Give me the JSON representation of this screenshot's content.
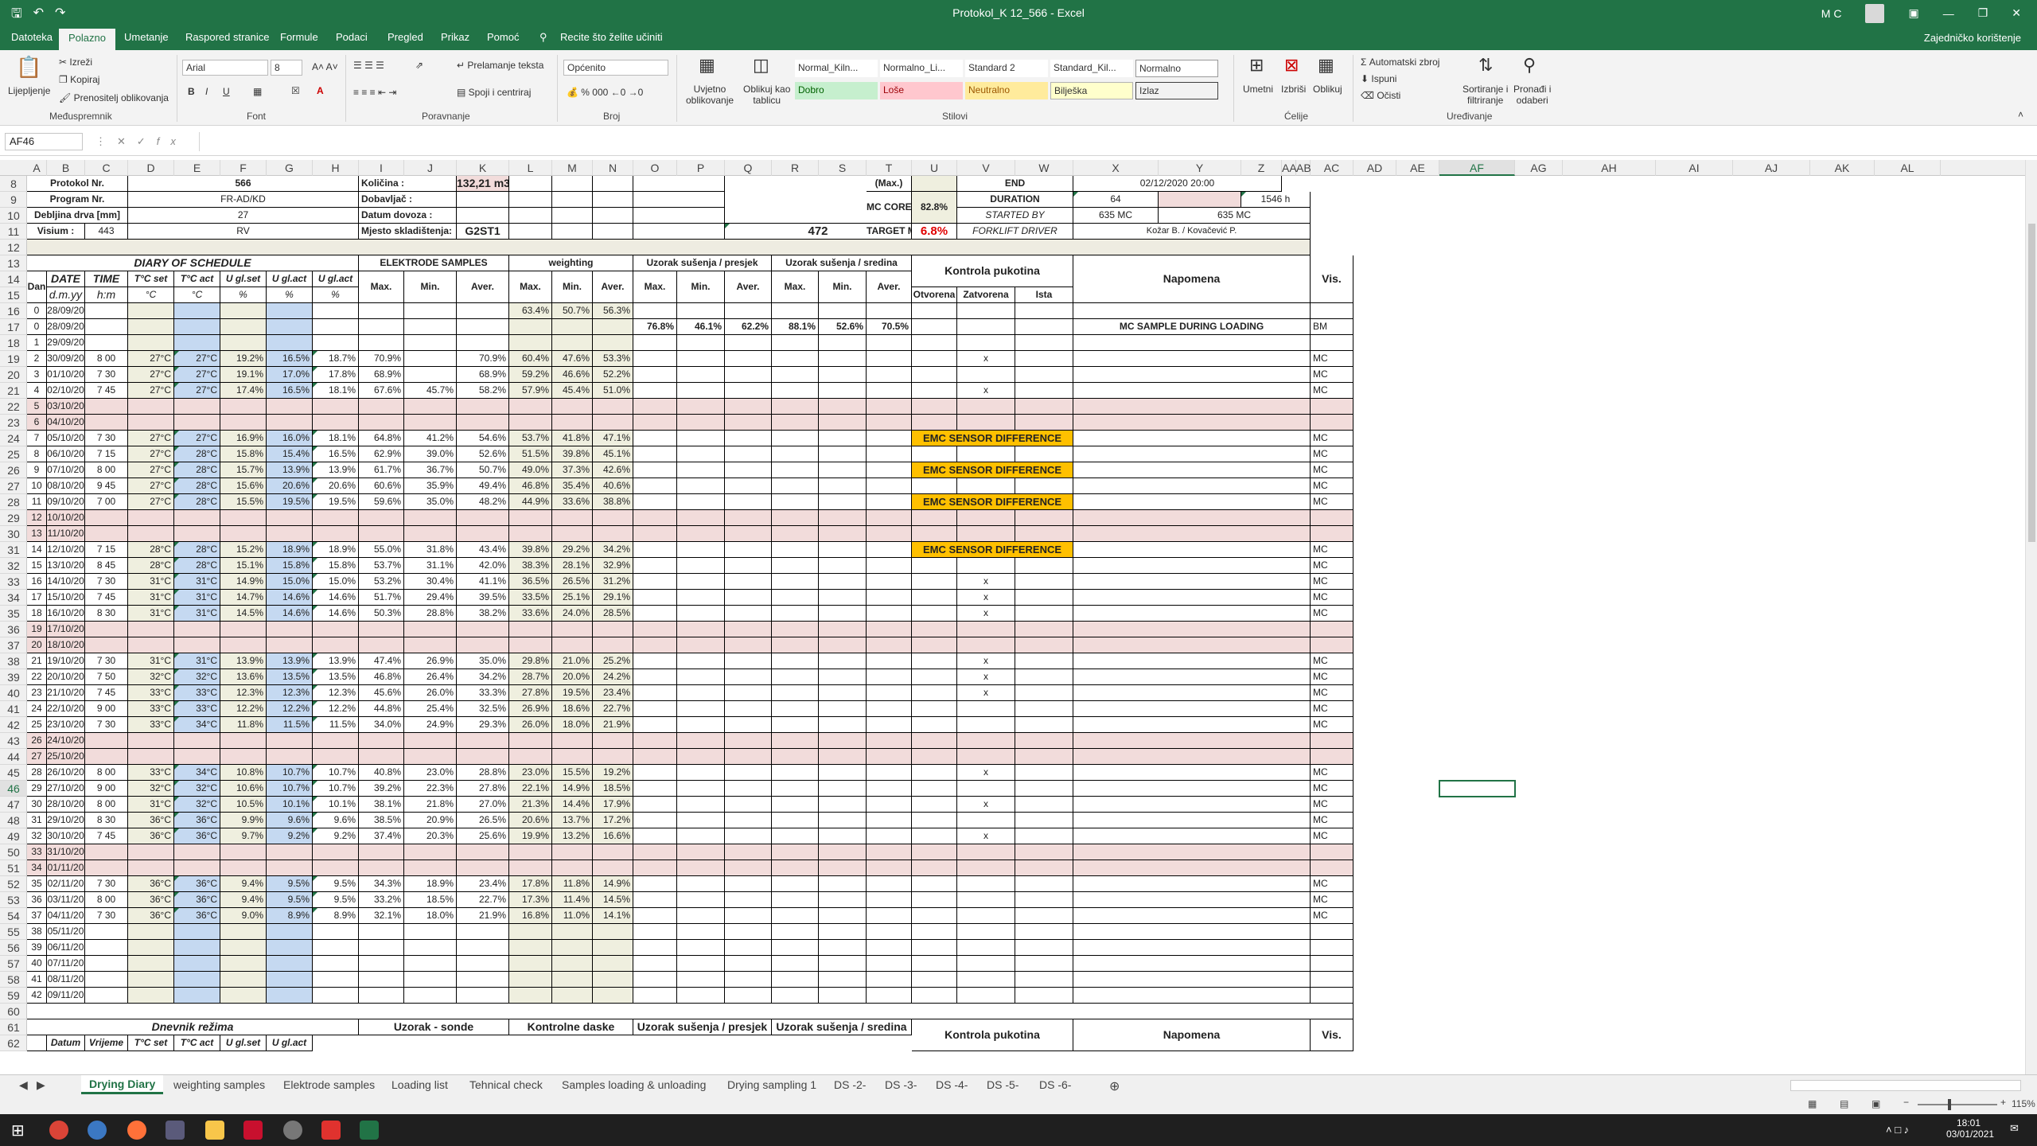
{
  "window": {
    "title": "Protokol_K 12_566  -  Excel",
    "user": "M C",
    "share": "Zajedničko korištenje"
  },
  "tabs": [
    "Datoteka",
    "Polazno",
    "Umetanje",
    "Raspored stranice",
    "Formule",
    "Podaci",
    "Pregled",
    "Prikaz",
    "Pomoć",
    "Recite što želite učiniti"
  ],
  "ribbon": {
    "clipboard": {
      "paste": "Lijepljenje",
      "cut": "Izreži",
      "copy": "Kopiraj",
      "painter": "Prenositelj oblikovanja",
      "group": "Međuspremnik"
    },
    "font": {
      "name": "Arial",
      "size": "8",
      "group": "Font"
    },
    "align": {
      "wrap": "Prelamanje teksta",
      "merge": "Spoji i centriraj",
      "group": "Poravnanje"
    },
    "number": {
      "format": "Općenito",
      "group": "Broj"
    },
    "styles": {
      "cond1": "Uvjetno",
      "cond2": "oblikovanje",
      "table1": "Oblikuj kao",
      "table2": "tablicu",
      "group": "Stilovi",
      "items": [
        "Normal_Kiln...",
        "Normalno_Li...",
        "Standard 2",
        "Standard_Kil...",
        "Normalno",
        "Dobro",
        "Loše",
        "Neutralno",
        "Bilješka",
        "Izlaz"
      ]
    },
    "cells": {
      "insert": "Umetni",
      "delete": "Izbriši",
      "format": "Oblikuj",
      "group": "Ćelije"
    },
    "editing": {
      "autosum": "Automatski zbroj",
      "fill": "Ispuni",
      "clear": "Očisti",
      "sort1": "Sortiranje i",
      "sort2": "filtriranje",
      "find1": "Pronađi i",
      "find2": "odaberi",
      "group": "Uređivanje"
    }
  },
  "namebox": "AF46",
  "columns": [
    "A",
    "B",
    "C",
    "D",
    "E",
    "F",
    "G",
    "H",
    "I",
    "J",
    "K",
    "L",
    "M",
    "N",
    "O",
    "P",
    "Q",
    "R",
    "S",
    "T",
    "U",
    "V",
    "W",
    "X",
    "Y",
    "Z",
    "AA",
    "AB",
    "AC",
    "AD",
    "AE",
    "AF",
    "AG",
    "AH",
    "AI",
    "AJ",
    "AK",
    "AL"
  ],
  "rows": [
    "8",
    "9",
    "10",
    "11",
    "12",
    "13",
    "14",
    "15",
    "16",
    "17",
    "18",
    "19",
    "20",
    "21",
    "22",
    "23",
    "24",
    "25",
    "26",
    "27",
    "28",
    "29",
    "30",
    "31",
    "32",
    "33",
    "34",
    "35",
    "36",
    "37",
    "38",
    "39",
    "40",
    "41",
    "42",
    "43",
    "44",
    "45",
    "46",
    "47",
    "48",
    "49",
    "50",
    "51",
    "52",
    "53",
    "54",
    "55",
    "56",
    "57",
    "58",
    "59",
    "60",
    "61",
    "62"
  ],
  "header": {
    "protokol_l": "Protokol Nr.",
    "protokol_v": "566",
    "kolicina_l": "Količina :",
    "kolicina_v": "132,21 m3",
    "program_l": "Program Nr.",
    "program_v": "FR-AD/KD",
    "dobavljac_l": "Dobavljač :",
    "debljina_l": "Debljina drva [mm]",
    "debljina_v": "27",
    "datum_l": "Datum dovoza :",
    "visium_l": "Visium :",
    "visium_v": "443",
    "visium_rv": "RV",
    "mjesto_l": "Mjesto skladištenja:",
    "mjesto_v": "G2ST1",
    "v472": "472",
    "max_l": "(Max.)",
    "end_l": "END",
    "end_v": "02/12/2020 20:00",
    "mccore_l": "MC CORE (Max.)",
    "mccore_v": "82.8%",
    "duration_l": "DURATION",
    "duration_v1": "64",
    "duration_v2": "1546 h",
    "started_l": "STARTED BY",
    "started_v1": "635 MC",
    "started_v2": "635 MC",
    "target_l": "TARGET MC",
    "target_v": "6.8%",
    "fork_l": "FORKLIFT DRIVER",
    "fork_v": "Kožar B. / Kovačević P."
  },
  "table_head": {
    "diary": "DIARY OF SCHEDULE",
    "dan": "Dan",
    "date": "DATE",
    "time": "TIME",
    "tset": "T°C set",
    "tact": "T°C act",
    "uset": "U gl.set",
    "uact": "U gl.act",
    "uact2": "U gl.act",
    "dmy": "d.m.yy",
    "hm": "h:m",
    "c": "°C",
    "pct": "%",
    "elektrode": "ELEKTRODE SAMPLES",
    "weighting": "weighting",
    "presjek": "Uzorak sušenja / presjek",
    "sredina": "Uzorak sušenja / sredina",
    "max": "Max.",
    "min": "Min.",
    "aver": "Aver.",
    "kontrola": "Kontrola pukotina",
    "otvorena": "Otvorena",
    "zatvorena": "Zatvorena",
    "ista": "Ista",
    "napomena": "Napomena",
    "vis": "Vis."
  },
  "data_rows": [
    [
      "0",
      "28/09/20",
      "",
      "",
      "",
      "",
      "",
      "",
      "",
      "",
      "",
      "63.4%",
      "50.7%",
      "56.3%",
      "",
      "",
      "",
      "",
      "",
      "",
      "",
      "",
      "",
      "",
      "",
      ""
    ],
    [
      "0",
      "28/09/20",
      "",
      "",
      "",
      "",
      "",
      "",
      "",
      "",
      "",
      "",
      "",
      "",
      "76.8%",
      "46.1%",
      "62.2%",
      "88.1%",
      "52.6%",
      "70.5%",
      "",
      "",
      "",
      "",
      "MC SAMPLE DURING LOADING",
      "BM"
    ],
    [
      "1",
      "29/09/20",
      "",
      "",
      "",
      "",
      "",
      "",
      "",
      "",
      "",
      "",
      "",
      "",
      "",
      "",
      "",
      "",
      "",
      "",
      "",
      "",
      "",
      "",
      "",
      ""
    ],
    [
      "2",
      "30/09/20",
      "8 00",
      "27°C",
      "27°C",
      "19.2%",
      "16.5%",
      "18.7%",
      "70.9%",
      "",
      "70.9%",
      "60.4%",
      "47.6%",
      "53.3%",
      "",
      "",
      "",
      "",
      "",
      "",
      "",
      "x",
      "",
      "",
      "",
      "MC"
    ],
    [
      "3",
      "01/10/20",
      "7 30",
      "27°C",
      "27°C",
      "19.1%",
      "17.0%",
      "17.8%",
      "68.9%",
      "",
      "68.9%",
      "59.2%",
      "46.6%",
      "52.2%",
      "",
      "",
      "",
      "",
      "",
      "",
      "",
      "",
      "",
      "",
      "",
      "MC"
    ],
    [
      "4",
      "02/10/20",
      "7 45",
      "27°C",
      "27°C",
      "17.4%",
      "16.5%",
      "18.1%",
      "67.6%",
      "45.7%",
      "58.2%",
      "57.9%",
      "45.4%",
      "51.0%",
      "",
      "",
      "",
      "",
      "",
      "",
      "",
      "x",
      "",
      "",
      "",
      "MC"
    ],
    [
      "5",
      "03/10/20",
      "",
      "",
      "",
      "",
      "",
      "",
      "",
      "",
      "",
      "",
      "",
      "",
      "",
      "",
      "",
      "",
      "",
      "",
      "",
      "",
      "",
      "",
      "",
      ""
    ],
    [
      "6",
      "04/10/20",
      "",
      "",
      "",
      "",
      "",
      "",
      "",
      "",
      "",
      "",
      "",
      "",
      "",
      "",
      "",
      "",
      "",
      "",
      "",
      "",
      "",
      "",
      "",
      ""
    ],
    [
      "7",
      "05/10/20",
      "7 30",
      "27°C",
      "27°C",
      "16.9%",
      "16.0%",
      "18.1%",
      "64.8%",
      "41.2%",
      "54.6%",
      "53.7%",
      "41.8%",
      "47.1%",
      "",
      "",
      "",
      "",
      "",
      "",
      "EMC SENSOR DIFFERENCE",
      "",
      "",
      "",
      "",
      "MC"
    ],
    [
      "8",
      "06/10/20",
      "7 15",
      "27°C",
      "28°C",
      "15.8%",
      "15.4%",
      "16.5%",
      "62.9%",
      "39.0%",
      "52.6%",
      "51.5%",
      "39.8%",
      "45.1%",
      "",
      "",
      "",
      "",
      "",
      "",
      "",
      "",
      "",
      "",
      "",
      "MC"
    ],
    [
      "9",
      "07/10/20",
      "8 00",
      "27°C",
      "28°C",
      "15.7%",
      "13.9%",
      "13.9%",
      "61.7%",
      "36.7%",
      "50.7%",
      "49.0%",
      "37.3%",
      "42.6%",
      "",
      "",
      "",
      "",
      "",
      "",
      "EMC SENSOR DIFFERENCE",
      "",
      "",
      "",
      "",
      "MC"
    ],
    [
      "10",
      "08/10/20",
      "9 45",
      "27°C",
      "28°C",
      "15.6%",
      "20.6%",
      "20.6%",
      "60.6%",
      "35.9%",
      "49.4%",
      "46.8%",
      "35.4%",
      "40.6%",
      "",
      "",
      "",
      "",
      "",
      "",
      "",
      "",
      "",
      "",
      "",
      "MC"
    ],
    [
      "11",
      "09/10/20",
      "7 00",
      "27°C",
      "28°C",
      "15.5%",
      "19.5%",
      "19.5%",
      "59.6%",
      "35.0%",
      "48.2%",
      "44.9%",
      "33.6%",
      "38.8%",
      "",
      "",
      "",
      "",
      "",
      "",
      "EMC SENSOR DIFFERENCE",
      "",
      "",
      "",
      "",
      "MC"
    ],
    [
      "12",
      "10/10/20",
      "",
      "",
      "",
      "",
      "",
      "",
      "",
      "",
      "",
      "",
      "",
      "",
      "",
      "",
      "",
      "",
      "",
      "",
      "",
      "",
      "",
      "",
      "",
      ""
    ],
    [
      "13",
      "11/10/20",
      "",
      "",
      "",
      "",
      "",
      "",
      "",
      "",
      "",
      "",
      "",
      "",
      "",
      "",
      "",
      "",
      "",
      "",
      "",
      "",
      "",
      "",
      "",
      ""
    ],
    [
      "14",
      "12/10/20",
      "7 15",
      "28°C",
      "28°C",
      "15.2%",
      "18.9%",
      "18.9%",
      "55.0%",
      "31.8%",
      "43.4%",
      "39.8%",
      "29.2%",
      "34.2%",
      "",
      "",
      "",
      "",
      "",
      "",
      "EMC SENSOR DIFFERENCE",
      "",
      "",
      "",
      "",
      "MC"
    ],
    [
      "15",
      "13/10/20",
      "8 45",
      "28°C",
      "28°C",
      "15.1%",
      "15.8%",
      "15.8%",
      "53.7%",
      "31.1%",
      "42.0%",
      "38.3%",
      "28.1%",
      "32.9%",
      "",
      "",
      "",
      "",
      "",
      "",
      "",
      "",
      "",
      "",
      "",
      "MC"
    ],
    [
      "16",
      "14/10/20",
      "7 30",
      "31°C",
      "31°C",
      "14.9%",
      "15.0%",
      "15.0%",
      "53.2%",
      "30.4%",
      "41.1%",
      "36.5%",
      "26.5%",
      "31.2%",
      "",
      "",
      "",
      "",
      "",
      "",
      "",
      "x",
      "",
      "",
      "",
      "MC"
    ],
    [
      "17",
      "15/10/20",
      "7 45",
      "31°C",
      "31°C",
      "14.7%",
      "14.6%",
      "14.6%",
      "51.7%",
      "29.4%",
      "39.5%",
      "33.5%",
      "25.1%",
      "29.1%",
      "",
      "",
      "",
      "",
      "",
      "",
      "",
      "x",
      "",
      "",
      "",
      "MC"
    ],
    [
      "18",
      "16/10/20",
      "8 30",
      "31°C",
      "31°C",
      "14.5%",
      "14.6%",
      "14.6%",
      "50.3%",
      "28.8%",
      "38.2%",
      "33.6%",
      "24.0%",
      "28.5%",
      "",
      "",
      "",
      "",
      "",
      "",
      "",
      "x",
      "",
      "",
      "",
      "MC"
    ],
    [
      "19",
      "17/10/20",
      "",
      "",
      "",
      "",
      "",
      "",
      "",
      "",
      "",
      "",
      "",
      "",
      "",
      "",
      "",
      "",
      "",
      "",
      "",
      "",
      "",
      "",
      "",
      ""
    ],
    [
      "20",
      "18/10/20",
      "",
      "",
      "",
      "",
      "",
      "",
      "",
      "",
      "",
      "",
      "",
      "",
      "",
      "",
      "",
      "",
      "",
      "",
      "",
      "",
      "",
      "",
      "",
      ""
    ],
    [
      "21",
      "19/10/20",
      "7 30",
      "31°C",
      "31°C",
      "13.9%",
      "13.9%",
      "13.9%",
      "47.4%",
      "26.9%",
      "35.0%",
      "29.8%",
      "21.0%",
      "25.2%",
      "",
      "",
      "",
      "",
      "",
      "",
      "",
      "x",
      "",
      "",
      "",
      "MC"
    ],
    [
      "22",
      "20/10/20",
      "7 50",
      "32°C",
      "32°C",
      "13.6%",
      "13.5%",
      "13.5%",
      "46.8%",
      "26.4%",
      "34.2%",
      "28.7%",
      "20.0%",
      "24.2%",
      "",
      "",
      "",
      "",
      "",
      "",
      "",
      "x",
      "",
      "",
      "",
      "MC"
    ],
    [
      "23",
      "21/10/20",
      "7 45",
      "33°C",
      "33°C",
      "12.3%",
      "12.3%",
      "12.3%",
      "45.6%",
      "26.0%",
      "33.3%",
      "27.8%",
      "19.5%",
      "23.4%",
      "",
      "",
      "",
      "",
      "",
      "",
      "",
      "x",
      "",
      "",
      "",
      "MC"
    ],
    [
      "24",
      "22/10/20",
      "9 00",
      "33°C",
      "33°C",
      "12.2%",
      "12.2%",
      "12.2%",
      "44.8%",
      "25.4%",
      "32.5%",
      "26.9%",
      "18.6%",
      "22.7%",
      "",
      "",
      "",
      "",
      "",
      "",
      "",
      "",
      "",
      "",
      "",
      "MC"
    ],
    [
      "25",
      "23/10/20",
      "7 30",
      "33°C",
      "34°C",
      "11.8%",
      "11.5%",
      "11.5%",
      "34.0%",
      "24.9%",
      "29.3%",
      "26.0%",
      "18.0%",
      "21.9%",
      "",
      "",
      "",
      "",
      "",
      "",
      "",
      "",
      "",
      "",
      "",
      "MC"
    ],
    [
      "26",
      "24/10/20",
      "",
      "",
      "",
      "",
      "",
      "",
      "",
      "",
      "",
      "",
      "",
      "",
      "",
      "",
      "",
      "",
      "",
      "",
      "",
      "",
      "",
      "",
      "",
      ""
    ],
    [
      "27",
      "25/10/20",
      "",
      "",
      "",
      "",
      "",
      "",
      "",
      "",
      "",
      "",
      "",
      "",
      "",
      "",
      "",
      "",
      "",
      "",
      "",
      "",
      "",
      "",
      "",
      ""
    ],
    [
      "28",
      "26/10/20",
      "8 00",
      "33°C",
      "34°C",
      "10.8%",
      "10.7%",
      "10.7%",
      "40.8%",
      "23.0%",
      "28.8%",
      "23.0%",
      "15.5%",
      "19.2%",
      "",
      "",
      "",
      "",
      "",
      "",
      "",
      "x",
      "",
      "",
      "",
      "MC"
    ],
    [
      "29",
      "27/10/20",
      "9 00",
      "32°C",
      "32°C",
      "10.6%",
      "10.7%",
      "10.7%",
      "39.2%",
      "22.3%",
      "27.8%",
      "22.1%",
      "14.9%",
      "18.5%",
      "",
      "",
      "",
      "",
      "",
      "",
      "",
      "",
      "",
      "",
      "",
      "MC"
    ],
    [
      "30",
      "28/10/20",
      "8 00",
      "31°C",
      "32°C",
      "10.5%",
      "10.1%",
      "10.1%",
      "38.1%",
      "21.8%",
      "27.0%",
      "21.3%",
      "14.4%",
      "17.9%",
      "",
      "",
      "",
      "",
      "",
      "",
      "",
      "x",
      "",
      "",
      "",
      "MC"
    ],
    [
      "31",
      "29/10/20",
      "8 30",
      "36°C",
      "36°C",
      "9.9%",
      "9.6%",
      "9.6%",
      "38.5%",
      "20.9%",
      "26.5%",
      "20.6%",
      "13.7%",
      "17.2%",
      "",
      "",
      "",
      "",
      "",
      "",
      "",
      "",
      "",
      "",
      "",
      "MC"
    ],
    [
      "32",
      "30/10/20",
      "7 45",
      "36°C",
      "36°C",
      "9.7%",
      "9.2%",
      "9.2%",
      "37.4%",
      "20.3%",
      "25.6%",
      "19.9%",
      "13.2%",
      "16.6%",
      "",
      "",
      "",
      "",
      "",
      "",
      "",
      "x",
      "",
      "",
      "",
      "MC"
    ],
    [
      "33",
      "31/10/20",
      "",
      "",
      "",
      "",
      "",
      "",
      "",
      "",
      "",
      "",
      "",
      "",
      "",
      "",
      "",
      "",
      "",
      "",
      "",
      "",
      "",
      "",
      "",
      ""
    ],
    [
      "34",
      "01/11/20",
      "",
      "",
      "",
      "",
      "",
      "",
      "",
      "",
      "",
      "",
      "",
      "",
      "",
      "",
      "",
      "",
      "",
      "",
      "",
      "",
      "",
      "",
      "",
      ""
    ],
    [
      "35",
      "02/11/20",
      "7 30",
      "36°C",
      "36°C",
      "9.4%",
      "9.5%",
      "9.5%",
      "34.3%",
      "18.9%",
      "23.4%",
      "17.8%",
      "11.8%",
      "14.9%",
      "",
      "",
      "",
      "",
      "",
      "",
      "",
      "",
      "",
      "",
      "",
      "MC"
    ],
    [
      "36",
      "03/11/20",
      "8 00",
      "36°C",
      "36°C",
      "9.4%",
      "9.5%",
      "9.5%",
      "33.2%",
      "18.5%",
      "22.7%",
      "17.3%",
      "11.4%",
      "14.5%",
      "",
      "",
      "",
      "",
      "",
      "",
      "",
      "",
      "",
      "",
      "",
      "MC"
    ],
    [
      "37",
      "04/11/20",
      "7 30",
      "36°C",
      "36°C",
      "9.0%",
      "8.9%",
      "8.9%",
      "32.1%",
      "18.0%",
      "21.9%",
      "16.8%",
      "11.0%",
      "14.1%",
      "",
      "",
      "",
      "",
      "",
      "",
      "",
      "",
      "",
      "",
      "",
      "MC"
    ],
    [
      "38",
      "05/11/20",
      "",
      "",
      "",
      "",
      "",
      "",
      "",
      "",
      "",
      "",
      "",
      "",
      "",
      "",
      "",
      "",
      "",
      "",
      "",
      "",
      "",
      "",
      "",
      ""
    ],
    [
      "39",
      "06/11/20",
      "",
      "",
      "",
      "",
      "",
      "",
      "",
      "",
      "",
      "",
      "",
      "",
      "",
      "",
      "",
      "",
      "",
      "",
      "",
      "",
      "",
      "",
      "",
      ""
    ],
    [
      "40",
      "07/11/20",
      "",
      "",
      "",
      "",
      "",
      "",
      "",
      "",
      "",
      "",
      "",
      "",
      "",
      "",
      "",
      "",
      "",
      "",
      "",
      "",
      "",
      "",
      "",
      ""
    ],
    [
      "41",
      "08/11/20",
      "",
      "",
      "",
      "",
      "",
      "",
      "",
      "",
      "",
      "",
      "",
      "",
      "",
      "",
      "",
      "",
      "",
      "",
      "",
      "",
      "",
      "",
      "",
      ""
    ],
    [
      "42",
      "09/11/20",
      "",
      "",
      "",
      "",
      "",
      "",
      "",
      "",
      "",
      "",
      "",
      "",
      "",
      "",
      "",
      "",
      "",
      "",
      "",
      "",
      "",
      "",
      "",
      ""
    ]
  ],
  "lower_head": {
    "dnevnik": "Dnevnik režima",
    "sonde": "Uzorak - sonde",
    "kontrolne": "Kontrolne daske",
    "presjek": "Uzorak sušenja / presjek",
    "sredina": "Uzorak sušenja / sredina",
    "kontrola": "Kontrola pukotina",
    "napomena": "Napomena",
    "vis": "Vis.",
    "datum": "Datum",
    "vrijeme": "Vrijeme",
    "tset": "T°C set",
    "tact": "T°C act",
    "uset": "U gl.set",
    "uact": "U gl.act"
  },
  "sheet_tabs": [
    "Drying Diary",
    "weighting samples",
    "Elektrode samples",
    "Loading list",
    "Tehnical check",
    "Samples loading & unloading",
    "Drying sampling 1",
    "DS -2-",
    "DS -3-",
    "DS -4-",
    "DS -5-",
    "DS -6-"
  ],
  "status": {
    "zoom": "115%"
  },
  "taskbar": {
    "time": "18:01",
    "date": "03/01/2021"
  }
}
